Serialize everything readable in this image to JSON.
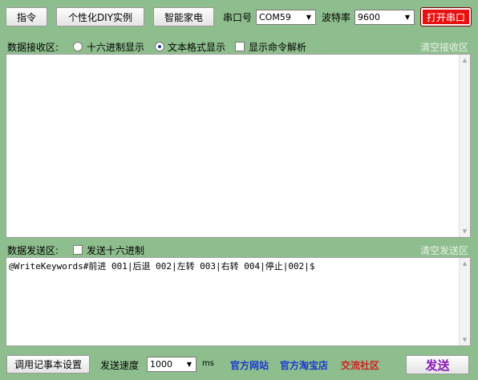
{
  "toolbar": {
    "cmd_label": "指令",
    "diy_label": "个性化DIY实例",
    "home_label": "智能家电",
    "port_label": "串口号",
    "port_value": "COM59",
    "baud_label": "波特率",
    "baud_value": "9600",
    "open_label": "打开串口"
  },
  "receive": {
    "title": "数据接收区:",
    "hex_label": "十六进制显示",
    "text_label": "文本格式显示",
    "parse_label": "显示命令解析",
    "clear_label": "清空接收区",
    "content": ""
  },
  "send": {
    "title": "数据发送区:",
    "hex_label": "发送十六进制",
    "clear_label": "清空发送区",
    "content": "@WriteKeywords#前进 001|后退 002|左转 003|右转 004|停止|002|$"
  },
  "bottom": {
    "notepad_label": "调用记事本设置",
    "speed_label": "发送速度",
    "speed_value": "1000",
    "unit_label": "ms",
    "site_link": "官方网站",
    "shop_link": "官方淘宝店",
    "community_link": "交流社区",
    "send_label": "发送"
  },
  "colors": {
    "background": "#8fbe8e",
    "link_blue": "#1a3ccc",
    "link_red": "#d02020",
    "send_purple": "#8a1bb8",
    "open_red": "#e81010"
  }
}
